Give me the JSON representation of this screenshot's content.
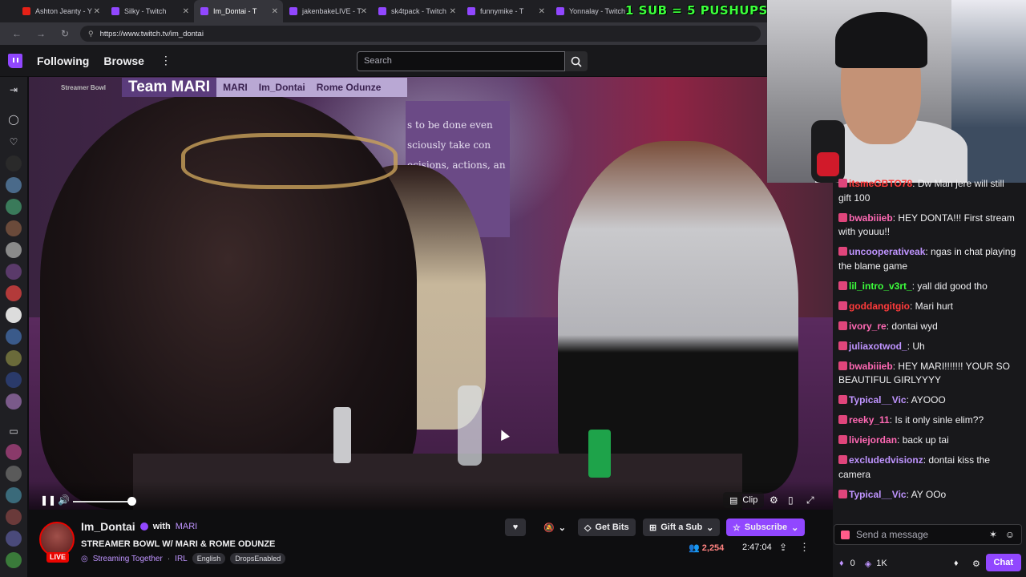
{
  "browser": {
    "tabs": [
      {
        "label": "Ashton Jeanty - Y",
        "color": "#e62117"
      },
      {
        "label": "Silky - Twitch",
        "color": "#9147ff"
      },
      {
        "label": "Im_Dontai - T",
        "color": "#9147ff"
      },
      {
        "label": "jakenbakeLIVE - T",
        "color": "#9147ff"
      },
      {
        "label": "sk4tpack - Twitch",
        "color": "#9147ff"
      },
      {
        "label": "funnymike - T",
        "color": "#9147ff"
      },
      {
        "label": "Yonnalay - Twitch",
        "color": "#9147ff"
      }
    ],
    "url": "https://www.twitch.tv/im_dontai"
  },
  "overlay_text": "1 SUB = 5 PUSHUPS",
  "topnav": {
    "following": "Following",
    "browse": "Browse",
    "search_placeholder": "Search"
  },
  "video": {
    "banner_logo": "Streamer Bowl",
    "banner_team": "Team MARI",
    "banner_names": [
      "MARI",
      "Im_Dontai",
      "Rome Odunze"
    ],
    "wall_text": "s to be done even\nsciously take con\necisions, actions, an",
    "clip_label": "Clip"
  },
  "channel": {
    "name": "Im_Dontai",
    "with": "with",
    "with_name": "MARI",
    "live": "LIVE",
    "title": "STREAMER BOWL W/ MARI & ROME ODUNZE",
    "streaming_together": "Streaming Together",
    "category": "IRL",
    "tags": [
      "English",
      "DropsEnabled"
    ],
    "viewers": "2,254",
    "uptime": "2:47:04",
    "buttons": {
      "bits": "Get Bits",
      "gift": "Gift a Sub",
      "subscribe": "Subscribe"
    }
  },
  "chat": {
    "messages": [
      {
        "user": "itsmeGBTO78",
        "color": "#ff3b3b",
        "text": "Dw Man jere will still gift 100"
      },
      {
        "user": "bwabiiieb",
        "color": "#ff69b4",
        "text": "HEY DONTA!!! First stream with youuu!!"
      },
      {
        "user": "uncooperativeak",
        "color": "#bf94ff",
        "text": "ngas in chat playing the blame game"
      },
      {
        "user": "lil_intro_v3rt_",
        "color": "#3cff3c",
        "text": "yall did good tho"
      },
      {
        "user": "goddangitgio",
        "color": "#ff3b3b",
        "text": "Mari hurt"
      },
      {
        "user": "ivory_re",
        "color": "#ff69b4",
        "text": "dontai wyd"
      },
      {
        "user": "juliaxotwod_",
        "color": "#bf94ff",
        "text": "Uh"
      },
      {
        "user": "bwabiiieb",
        "color": "#ff69b4",
        "text": "HEY MARI!!!!!!! YOUR SO BEAUTIFUL GIRLYYYY"
      },
      {
        "user": "Typical__Vic",
        "color": "#bf94ff",
        "text": "AYOOO"
      },
      {
        "user": "reeky_11",
        "color": "#ff69b4",
        "text": "Is it only sinle elim??"
      },
      {
        "user": "liviejordan",
        "color": "#ff69b4",
        "text": "back up tai"
      },
      {
        "user": "excludedvisionz",
        "color": "#bf94ff",
        "text": "dontai kiss the camera"
      },
      {
        "user": "Typical__Vic",
        "color": "#bf94ff",
        "text": "AY OOo"
      }
    ],
    "input_placeholder": "Send a message",
    "points_left": "0",
    "points": "1K",
    "chat_button": "Chat"
  }
}
